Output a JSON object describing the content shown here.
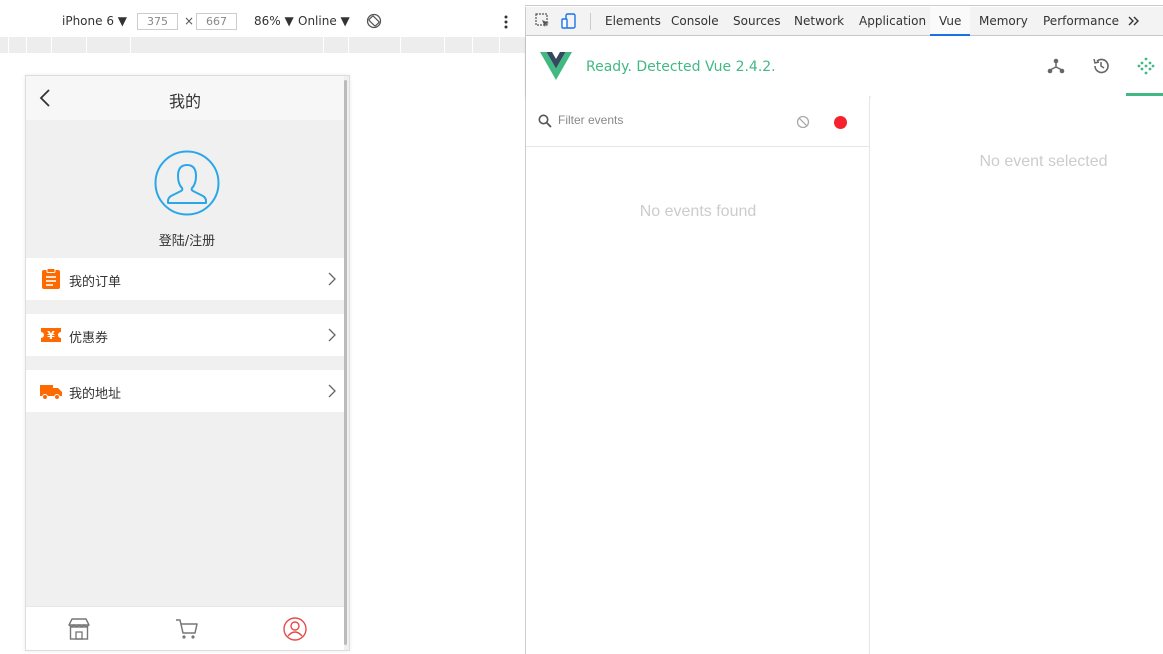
{
  "device_toolbar": {
    "device": "iPhone 6 ▼",
    "width": "375",
    "height": "667",
    "times": "×",
    "zoom": "86% ▼",
    "throttle": "Online ▼"
  },
  "phone": {
    "header_title": "我的",
    "login_label": "登陆/注册",
    "menu": [
      {
        "label": "我的订单",
        "icon": "clipboard-icon"
      },
      {
        "label": "优惠券",
        "icon": "coupon-icon"
      },
      {
        "label": "我的地址",
        "icon": "truck-icon"
      }
    ],
    "tabbar": [
      "store-icon",
      "cart-icon",
      "user-icon"
    ],
    "colors": {
      "accent": "#ff6a00",
      "avatar": "#2aa7e8",
      "active_tab": "#e84a4a"
    }
  },
  "devtools": {
    "tabs": [
      "Elements",
      "Console",
      "Sources",
      "Network",
      "Application",
      "Vue",
      "Memory",
      "Performance"
    ],
    "active_tab": "Vue",
    "vue_status": "Ready. Detected Vue 2.4.2.",
    "filter_placeholder": "Filter events",
    "no_events": "No events found",
    "no_selected": "No event selected",
    "colors": {
      "vue_green": "#42b983",
      "record": "#f5222d"
    }
  }
}
